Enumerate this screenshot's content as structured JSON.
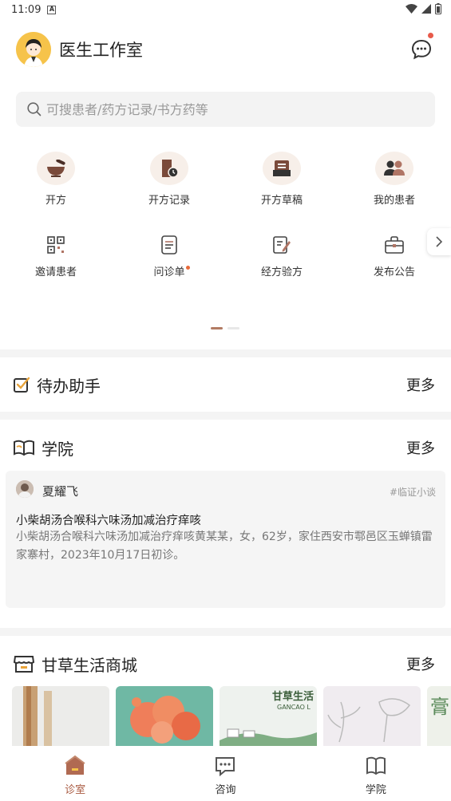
{
  "status": {
    "time": "11:09",
    "badge": "A"
  },
  "header": {
    "title": "医生工作室"
  },
  "search": {
    "placeholder": "可搜患者/药方记录/书方药等"
  },
  "grid": [
    {
      "label": "开方",
      "icon": "mortar-icon"
    },
    {
      "label": "开方记录",
      "icon": "record-clock-icon"
    },
    {
      "label": "开方草稿",
      "icon": "draft-tray-icon"
    },
    {
      "label": "我的患者",
      "icon": "patients-icon"
    },
    {
      "label": "邀请患者",
      "icon": "qr-invite-icon"
    },
    {
      "label": "问诊单",
      "icon": "form-icon"
    },
    {
      "label": "经方验方",
      "icon": "prescription-edit-icon"
    },
    {
      "label": "发布公告",
      "icon": "announcement-box-icon"
    }
  ],
  "todo": {
    "title": "待办助手",
    "more": "更多"
  },
  "academy": {
    "title": "学院",
    "more": "更多",
    "card": {
      "author": "夏耀飞",
      "tag": "#临证小谈",
      "title": "小柴胡汤合喉科六味汤加减治疗痒咳",
      "body": "小柴胡汤合喉科六味汤加减治疗痒咳黄某某，女，62岁，家住西安市鄠邑区玉蝉镇雷家寨村，2023年10月17日初诊。"
    }
  },
  "mall": {
    "title": "甘草生活商城",
    "more": "更多",
    "product3_text": "甘草生活",
    "product3_sub": "GANCAO L",
    "product5_text": "膏"
  },
  "tabs": [
    {
      "label": "诊室",
      "icon": "clinic-house-icon"
    },
    {
      "label": "咨询",
      "icon": "chat-bubble-icon"
    },
    {
      "label": "学院",
      "icon": "book-icon"
    }
  ],
  "colors": {
    "accent": "#a8583f",
    "pager_active": "#b27b63",
    "notify_dot": "#e85a4a"
  }
}
